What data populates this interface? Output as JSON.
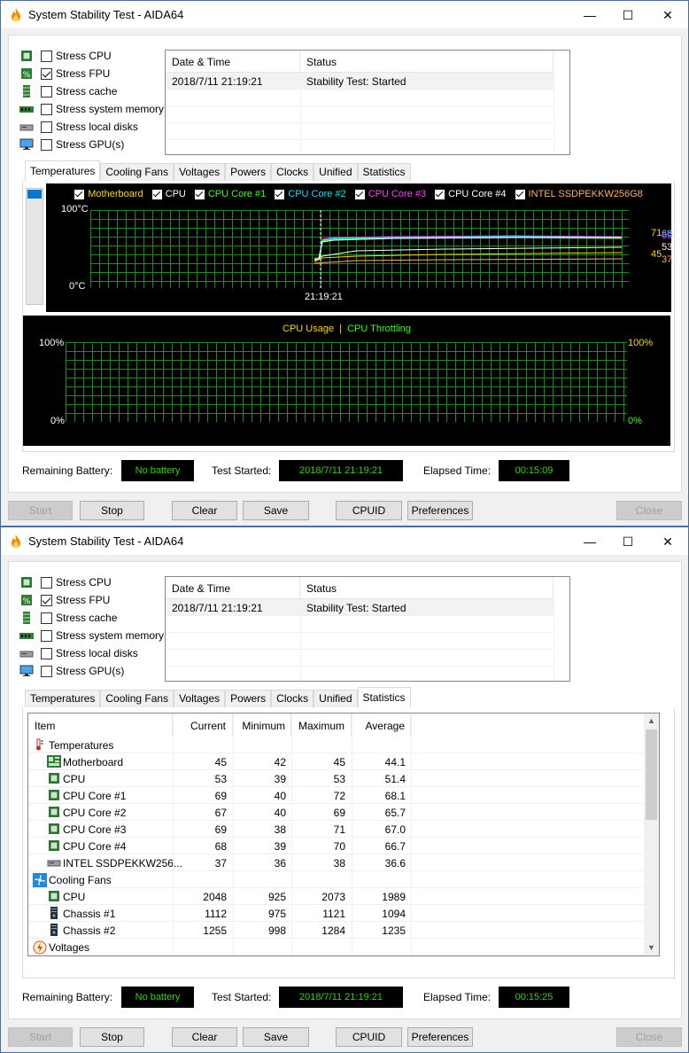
{
  "window_title": "System Stability Test - AIDA64",
  "window_controls": {
    "minimize": "—",
    "maximize": "☐",
    "close": "✕"
  },
  "stress_options": [
    {
      "label": "Stress CPU",
      "checked": false,
      "icon": "cpu-chip-icon"
    },
    {
      "label": "Stress FPU",
      "checked": true,
      "icon": "fpu-icon"
    },
    {
      "label": "Stress cache",
      "checked": false,
      "icon": "cache-icon"
    },
    {
      "label": "Stress system memory",
      "checked": false,
      "icon": "memory-icon"
    },
    {
      "label": "Stress local disks",
      "checked": false,
      "icon": "disk-icon"
    },
    {
      "label": "Stress GPU(s)",
      "checked": false,
      "icon": "monitor-icon"
    }
  ],
  "log": {
    "col_datetime": "Date & Time",
    "col_status": "Status",
    "rows": [
      {
        "datetime": "2018/7/11 21:19:21",
        "status": "Stability Test: Started"
      }
    ]
  },
  "tabs": [
    "Temperatures",
    "Cooling Fans",
    "Voltages",
    "Powers",
    "Clocks",
    "Unified",
    "Statistics"
  ],
  "temp_graph": {
    "legend": [
      {
        "label": "Motherboard",
        "color": "#ffd700"
      },
      {
        "label": "CPU",
        "color": "#ffffff"
      },
      {
        "label": "CPU Core #1",
        "color": "#39ff14"
      },
      {
        "label": "CPU Core #2",
        "color": "#00e5ff"
      },
      {
        "label": "CPU Core #3",
        "color": "#ff40ff"
      },
      {
        "label": "CPU Core #4",
        "color": "#ffffff"
      },
      {
        "label": "INTEL SSDPEKKW256G8",
        "color": "#ffb060"
      }
    ],
    "y_max_label": "100°C",
    "y_min_label": "0°C",
    "time_label": "21:19:21",
    "right_values": [
      {
        "text": "71",
        "color": "#ff40ff"
      },
      {
        "text": "68",
        "color": "#00e5ff"
      },
      {
        "text": "69",
        "color": "#ffffff"
      },
      {
        "text": "53",
        "color": "#ffffff"
      },
      {
        "text": "45",
        "color": "#ffd700"
      },
      {
        "text": "37",
        "color": "#ffb060"
      }
    ]
  },
  "usage_graph": {
    "label_usage": "CPU Usage",
    "separator": "|",
    "label_throttle": "CPU Throttling",
    "left_max": "100%",
    "left_min": "0%",
    "right_max": "100%",
    "right_min": "0%"
  },
  "window1_status": {
    "battery_label": "Remaining Battery:",
    "battery_value": "No battery",
    "started_label": "Test Started:",
    "started_value": "2018/7/11 21:19:21",
    "elapsed_label": "Elapsed Time:",
    "elapsed_value": "00:15:09"
  },
  "window2_status": {
    "battery_label": "Remaining Battery:",
    "battery_value": "No battery",
    "started_label": "Test Started:",
    "started_value": "2018/7/11 21:19:21",
    "elapsed_label": "Elapsed Time:",
    "elapsed_value": "00:15:25"
  },
  "buttons": {
    "start": "Start",
    "stop": "Stop",
    "clear": "Clear",
    "save": "Save",
    "cpuid": "CPUID",
    "preferences": "Preferences",
    "close": "Close"
  },
  "statistics": {
    "headers": [
      "Item",
      "Current",
      "Minimum",
      "Maximum",
      "Average"
    ],
    "rows": [
      {
        "type": "group",
        "name": "Temperatures",
        "icon": "thermometer-icon"
      },
      {
        "type": "item",
        "name": "Motherboard",
        "icon": "motherboard-icon",
        "current": "45",
        "minimum": "42",
        "maximum": "45",
        "average": "44.1"
      },
      {
        "type": "item",
        "name": "CPU",
        "icon": "cpu-chip-icon",
        "current": "53",
        "minimum": "39",
        "maximum": "53",
        "average": "51.4"
      },
      {
        "type": "item",
        "name": "CPU Core #1",
        "icon": "cpu-chip-icon",
        "current": "69",
        "minimum": "40",
        "maximum": "72",
        "average": "68.1"
      },
      {
        "type": "item",
        "name": "CPU Core #2",
        "icon": "cpu-chip-icon",
        "current": "67",
        "minimum": "40",
        "maximum": "69",
        "average": "65.7"
      },
      {
        "type": "item",
        "name": "CPU Core #3",
        "icon": "cpu-chip-icon",
        "current": "69",
        "minimum": "38",
        "maximum": "71",
        "average": "67.0"
      },
      {
        "type": "item",
        "name": "CPU Core #4",
        "icon": "cpu-chip-icon",
        "current": "68",
        "minimum": "39",
        "maximum": "70",
        "average": "66.7"
      },
      {
        "type": "item",
        "name": "INTEL SSDPEKKW256...",
        "icon": "disk-icon",
        "current": "37",
        "minimum": "36",
        "maximum": "38",
        "average": "36.6"
      },
      {
        "type": "group",
        "name": "Cooling Fans",
        "icon": "fan-icon"
      },
      {
        "type": "item",
        "name": "CPU",
        "icon": "cpu-chip-icon",
        "current": "2048",
        "minimum": "925",
        "maximum": "2073",
        "average": "1989"
      },
      {
        "type": "item",
        "name": "Chassis #1",
        "icon": "chassis-icon",
        "current": "1112",
        "minimum": "975",
        "maximum": "1121",
        "average": "1094"
      },
      {
        "type": "item",
        "name": "Chassis #2",
        "icon": "chassis-icon",
        "current": "1255",
        "minimum": "998",
        "maximum": "1284",
        "average": "1235"
      },
      {
        "type": "group",
        "name": "Voltages",
        "icon": "voltage-icon"
      }
    ]
  }
}
